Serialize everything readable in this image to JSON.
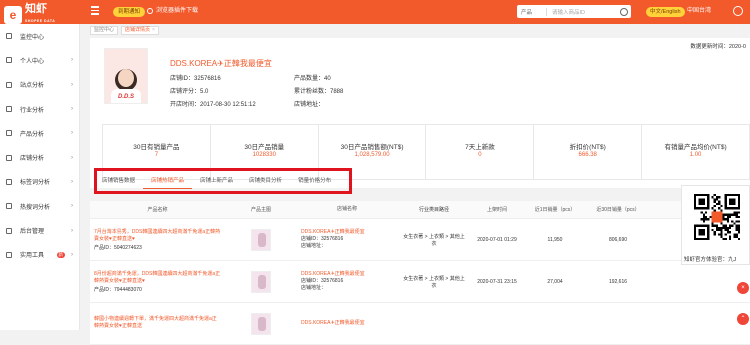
{
  "topbar": {
    "logo_char": "e",
    "logo_title": "知虾",
    "logo_sub": "SHOPEE DATA",
    "vip_label": "到期通知",
    "download_label": "浏览器插件下载",
    "search_select": "产品",
    "search_placeholder": "请输入商品ID",
    "lang_label": "中文/English",
    "site_label": "中国台湾"
  },
  "sidebar": {
    "items": [
      {
        "label": "监控中心",
        "arrow": ""
      },
      {
        "label": "个人中心",
        "arrow": "›"
      },
      {
        "label": "站点分析",
        "arrow": "›"
      },
      {
        "label": "行业分析",
        "arrow": "›"
      },
      {
        "label": "产品分析",
        "arrow": "›"
      },
      {
        "label": "店铺分析",
        "arrow": "›"
      },
      {
        "label": "标签词分析",
        "arrow": "›"
      },
      {
        "label": "热搜词分析",
        "arrow": "›"
      },
      {
        "label": "后台管理",
        "arrow": "›"
      },
      {
        "label": "实用工具",
        "arrow": "›",
        "badge": "新"
      }
    ]
  },
  "breadcrumb": {
    "home": "监控中心",
    "current": "店铺详情页",
    "close": "×"
  },
  "shop": {
    "update_time": "数据更新时间：2020-0",
    "avatar_text": "D.D.S",
    "title": "DDS.KOREA✈正韓我最便宜",
    "store_id": "店铺ID：32576816",
    "rating": "店铺评分：5.0",
    "open_time": "开店时间：2017-08-30 12:51:12",
    "product_count": "产品数量：40",
    "followers": "累计粉丝数：7888",
    "address": "店铺地址："
  },
  "stats": [
    {
      "label": "30日有销量产品",
      "value": "7"
    },
    {
      "label": "30日产品销量",
      "value": "1028330"
    },
    {
      "label": "30日产品销售额(NT$)",
      "value": "1,028,579.00"
    },
    {
      "label": "7天上新款",
      "value": "0"
    },
    {
      "label": "折扣价(NT$)",
      "value": "666.38"
    },
    {
      "label": "有销量产品均价(NT$)",
      "value": "1.00"
    }
  ],
  "tabs": [
    "店铺销售数据",
    "店铺热销产品",
    "店铺上新产品",
    "店铺类目分析",
    "销量价格分布"
  ],
  "table": {
    "headers": [
      "产品名称",
      "产品主图",
      "店铺名称",
      "行业类目路径",
      "上架时间",
      "近1日销量（pcs）",
      "近30日销量（pcs）"
    ],
    "rows": [
      {
        "title": "7月台灣本島秀，DDS韓國連續四大超商滿千免運a正韓熱賣女裝♥正韓直送♥",
        "id": "产品ID：5040274623",
        "shop": "DDS.KOREA✈正韓我最便宜",
        "shop_id": "店铺ID：32576816",
        "shop_addr": "店铺地址：",
        "category": "女生衣著 > 上衣類 > 其他上衣",
        "up_time": "2020-07-01 01:29",
        "sales_1d": "11,950",
        "sales_30d": "806,690"
      },
      {
        "title": "8月份超商滿千免運，DDS韓國連續四大超商滿千免運a正韓熱賣女裝♥正韓直送♥",
        "id": "产品ID：7944483070",
        "shop": "DDS.KOREA✈正韓我最便宜",
        "shop_id": "店铺ID：32576816",
        "shop_addr": "店铺地址：",
        "category": "女生衣著 > 上衣類 > 其他上衣",
        "up_time": "2020-07-31 23:15",
        "sales_1d": "27,004",
        "sales_30d": "192,616"
      },
      {
        "title": "韓國小物連續週轉下單，滿千免運四大超商滿千免運a正韓熱賣女裝♥正韓直送",
        "id": "",
        "shop": "DDS.KOREA✈正韓我最便宜",
        "shop_id": "",
        "shop_addr": "",
        "category": "",
        "up_time": "",
        "sales_1d": "",
        "sales_30d": ""
      }
    ]
  },
  "qr": {
    "caption": "知虾官方体验官：九J"
  },
  "colors": {
    "brand": "#f25a2c",
    "highlight": "#e0141e",
    "pill": "#ffd23a"
  }
}
